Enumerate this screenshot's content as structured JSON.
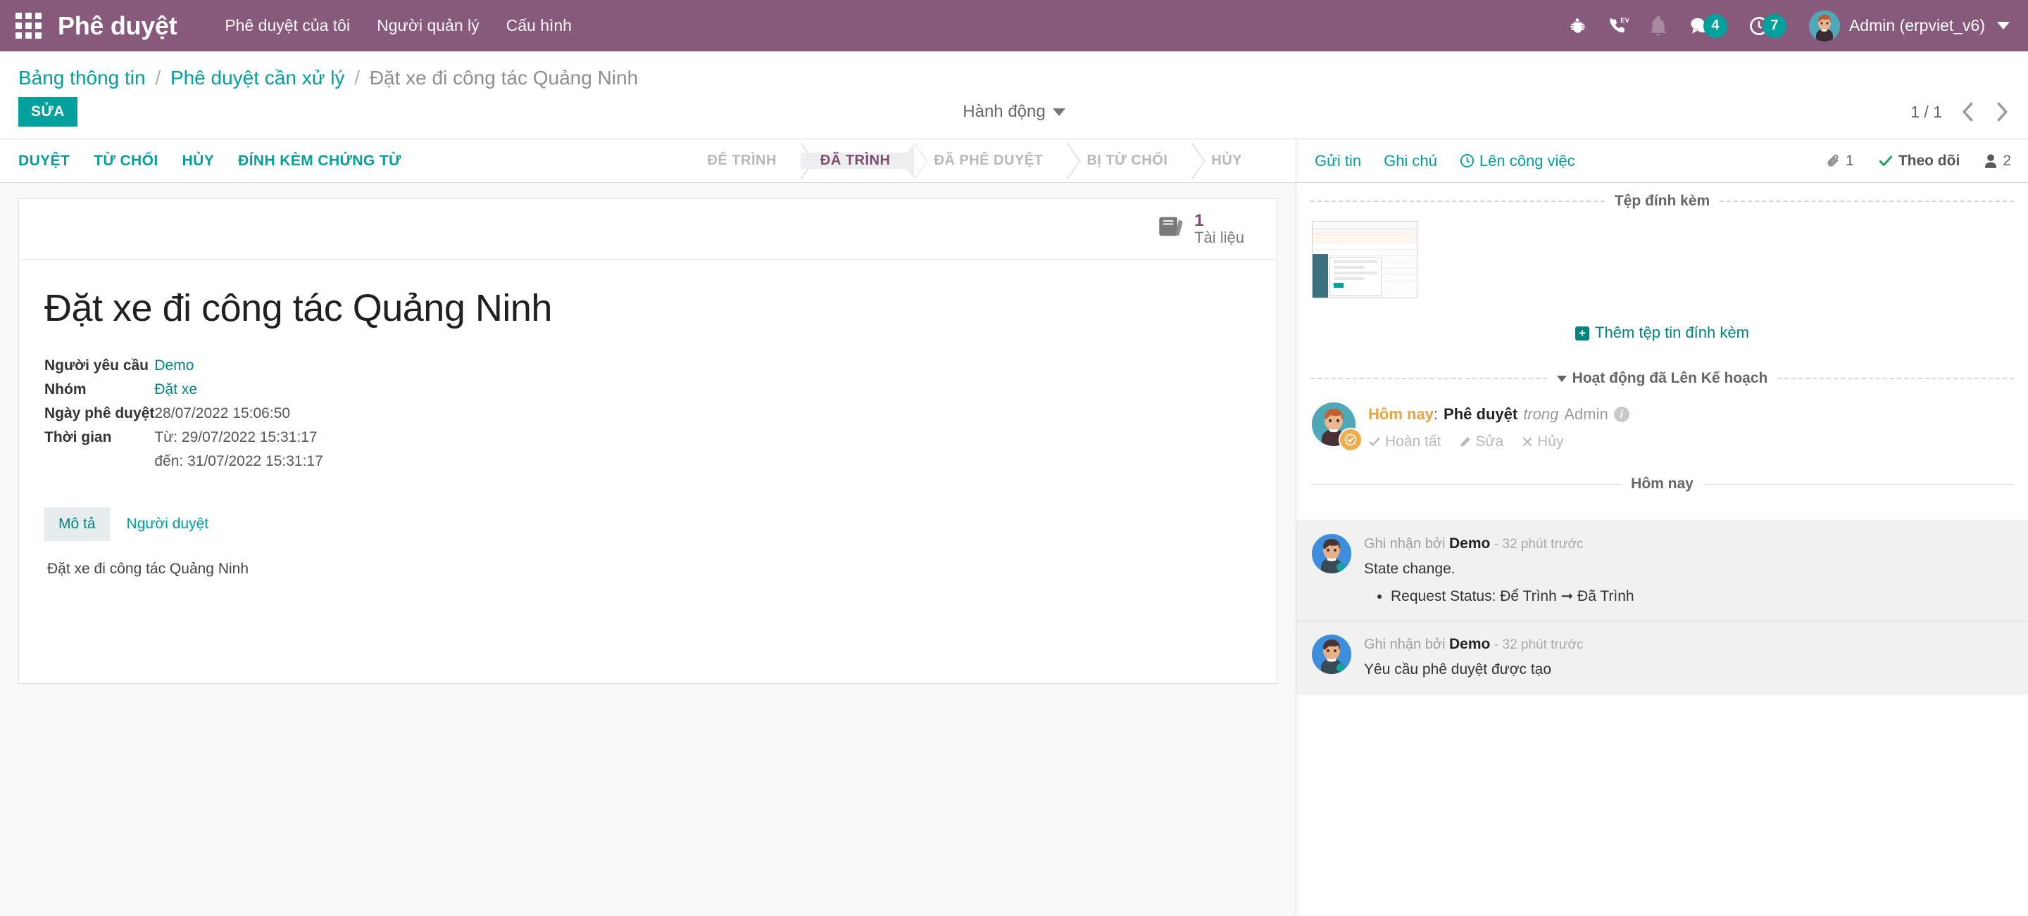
{
  "navbar": {
    "apps_icon": "apps-grid-icon",
    "brand": "Phê duyệt",
    "menu": [
      {
        "label": "Phê duyệt của tôi"
      },
      {
        "label": "Người quản lý"
      },
      {
        "label": "Cấu hình"
      }
    ],
    "icons": [
      {
        "name": "bug-icon"
      },
      {
        "name": "phone-ev-icon"
      },
      {
        "name": "bell-icon"
      }
    ],
    "messages_count": "4",
    "activities_count": "7",
    "user": "Admin (erpviet_v6)"
  },
  "control_panel": {
    "breadcrumb": [
      {
        "label": "Bảng thông tin",
        "link": true
      },
      {
        "label": "Phê duyệt cần xử lý",
        "link": true
      },
      {
        "label": "Đặt xe đi công tác Quảng Ninh",
        "link": false
      }
    ],
    "separator": "/",
    "edit_label": "SỬA",
    "action_label": "Hành động",
    "pager": "1 / 1"
  },
  "statusbar": {
    "buttons": [
      {
        "label": "DUYỆT"
      },
      {
        "label": "TỪ CHỐI"
      },
      {
        "label": "HỦY"
      },
      {
        "label": "ĐÍNH KÈM CHỨNG TỪ"
      }
    ],
    "states": [
      {
        "label": "ĐỂ TRÌNH",
        "active": false
      },
      {
        "label": "ĐÃ TRÌNH",
        "active": true
      },
      {
        "label": "ĐÃ PHÊ DUYỆT",
        "active": false
      },
      {
        "label": "BỊ TỪ CHỐI",
        "active": false
      },
      {
        "label": "HỦY",
        "active": false
      }
    ]
  },
  "chatter_header": {
    "send_message": "Gửi tin",
    "log_note": "Ghi chú",
    "schedule_activity": "Lên công việc",
    "attachment_count": "1",
    "follow_label": "Theo dõi",
    "followers_count": "2"
  },
  "form": {
    "smart_button": {
      "icon": "book-icon",
      "value": "1",
      "label": "Tài liệu"
    },
    "title": "Đặt xe đi công tác Quảng Ninh",
    "fields": [
      {
        "label": "Người yêu cầu",
        "value": "Demo",
        "link": true
      },
      {
        "label": "Nhóm",
        "value": "Đặt xe",
        "link": true
      },
      {
        "label": "Ngày phê duyệt",
        "value": "28/07/2022 15:06:50",
        "link": false
      },
      {
        "label": "Thời gian",
        "value": "Từ: 29/07/2022 15:31:17",
        "value2": "đến: 31/07/2022 15:31:17",
        "link": false
      }
    ],
    "tabs": [
      {
        "label": "Mô tả",
        "active": true
      },
      {
        "label": "Người duyệt",
        "active": false
      }
    ],
    "description": "Đặt xe đi công tác Quảng Ninh"
  },
  "chatter": {
    "attachments_title": "Tệp đính kèm",
    "add_attachment": "Thêm tệp tin đính kèm",
    "activities_title": "Hoạt động đã Lên Kế hoạch",
    "activity": {
      "when": "Hôm nay",
      "colon": ":",
      "name": "Phê duyệt",
      "in_label": "trong",
      "user": "Admin",
      "actions": [
        {
          "label": "Hoàn tất",
          "icon": "check-icon"
        },
        {
          "label": "Sửa",
          "icon": "pencil-icon"
        },
        {
          "label": "Hủy",
          "icon": "x-icon"
        }
      ]
    },
    "thread_title": "Hôm nay",
    "messages": [
      {
        "prefix": "Ghi nhận bởi",
        "author": "Demo",
        "time": "- 32 phút trước",
        "text": "State change.",
        "bullets": [
          "Request Status: Để Trình ➞ Đã Trình"
        ]
      },
      {
        "prefix": "Ghi nhận bởi",
        "author": "Demo",
        "time": "- 32 phút trước",
        "text": "Yêu cầu phê duyệt được tạo",
        "bullets": []
      }
    ]
  },
  "colors": {
    "brand_purple": "#875A7B",
    "accent_teal": "#00A09D",
    "link_teal": "#00847E",
    "state_active_text": "#7D4C6E",
    "badge_teal": "#00A09D",
    "activity_orange": "#E8A33D"
  }
}
